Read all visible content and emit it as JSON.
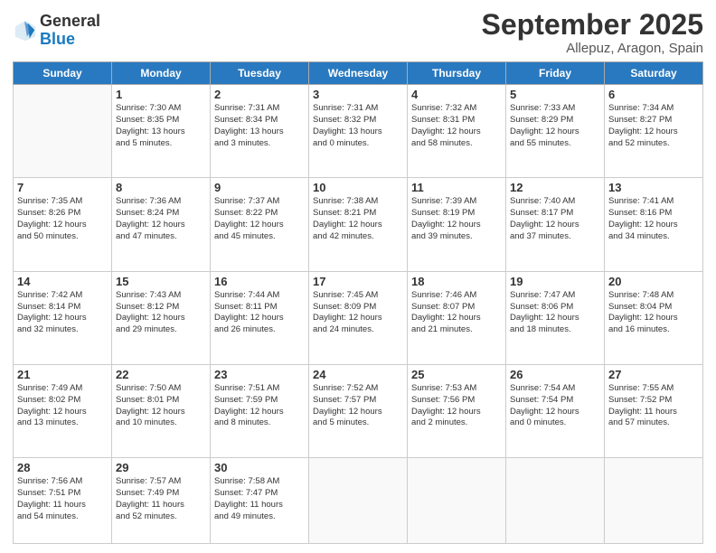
{
  "logo": {
    "general": "General",
    "blue": "Blue"
  },
  "header": {
    "title": "September 2025",
    "subtitle": "Allepuz, Aragon, Spain"
  },
  "days_of_week": [
    "Sunday",
    "Monday",
    "Tuesday",
    "Wednesday",
    "Thursday",
    "Friday",
    "Saturday"
  ],
  "weeks": [
    [
      {
        "day": "",
        "info": ""
      },
      {
        "day": "1",
        "info": "Sunrise: 7:30 AM\nSunset: 8:35 PM\nDaylight: 13 hours\nand 5 minutes."
      },
      {
        "day": "2",
        "info": "Sunrise: 7:31 AM\nSunset: 8:34 PM\nDaylight: 13 hours\nand 3 minutes."
      },
      {
        "day": "3",
        "info": "Sunrise: 7:31 AM\nSunset: 8:32 PM\nDaylight: 13 hours\nand 0 minutes."
      },
      {
        "day": "4",
        "info": "Sunrise: 7:32 AM\nSunset: 8:31 PM\nDaylight: 12 hours\nand 58 minutes."
      },
      {
        "day": "5",
        "info": "Sunrise: 7:33 AM\nSunset: 8:29 PM\nDaylight: 12 hours\nand 55 minutes."
      },
      {
        "day": "6",
        "info": "Sunrise: 7:34 AM\nSunset: 8:27 PM\nDaylight: 12 hours\nand 52 minutes."
      }
    ],
    [
      {
        "day": "7",
        "info": "Sunrise: 7:35 AM\nSunset: 8:26 PM\nDaylight: 12 hours\nand 50 minutes."
      },
      {
        "day": "8",
        "info": "Sunrise: 7:36 AM\nSunset: 8:24 PM\nDaylight: 12 hours\nand 47 minutes."
      },
      {
        "day": "9",
        "info": "Sunrise: 7:37 AM\nSunset: 8:22 PM\nDaylight: 12 hours\nand 45 minutes."
      },
      {
        "day": "10",
        "info": "Sunrise: 7:38 AM\nSunset: 8:21 PM\nDaylight: 12 hours\nand 42 minutes."
      },
      {
        "day": "11",
        "info": "Sunrise: 7:39 AM\nSunset: 8:19 PM\nDaylight: 12 hours\nand 39 minutes."
      },
      {
        "day": "12",
        "info": "Sunrise: 7:40 AM\nSunset: 8:17 PM\nDaylight: 12 hours\nand 37 minutes."
      },
      {
        "day": "13",
        "info": "Sunrise: 7:41 AM\nSunset: 8:16 PM\nDaylight: 12 hours\nand 34 minutes."
      }
    ],
    [
      {
        "day": "14",
        "info": "Sunrise: 7:42 AM\nSunset: 8:14 PM\nDaylight: 12 hours\nand 32 minutes."
      },
      {
        "day": "15",
        "info": "Sunrise: 7:43 AM\nSunset: 8:12 PM\nDaylight: 12 hours\nand 29 minutes."
      },
      {
        "day": "16",
        "info": "Sunrise: 7:44 AM\nSunset: 8:11 PM\nDaylight: 12 hours\nand 26 minutes."
      },
      {
        "day": "17",
        "info": "Sunrise: 7:45 AM\nSunset: 8:09 PM\nDaylight: 12 hours\nand 24 minutes."
      },
      {
        "day": "18",
        "info": "Sunrise: 7:46 AM\nSunset: 8:07 PM\nDaylight: 12 hours\nand 21 minutes."
      },
      {
        "day": "19",
        "info": "Sunrise: 7:47 AM\nSunset: 8:06 PM\nDaylight: 12 hours\nand 18 minutes."
      },
      {
        "day": "20",
        "info": "Sunrise: 7:48 AM\nSunset: 8:04 PM\nDaylight: 12 hours\nand 16 minutes."
      }
    ],
    [
      {
        "day": "21",
        "info": "Sunrise: 7:49 AM\nSunset: 8:02 PM\nDaylight: 12 hours\nand 13 minutes."
      },
      {
        "day": "22",
        "info": "Sunrise: 7:50 AM\nSunset: 8:01 PM\nDaylight: 12 hours\nand 10 minutes."
      },
      {
        "day": "23",
        "info": "Sunrise: 7:51 AM\nSunset: 7:59 PM\nDaylight: 12 hours\nand 8 minutes."
      },
      {
        "day": "24",
        "info": "Sunrise: 7:52 AM\nSunset: 7:57 PM\nDaylight: 12 hours\nand 5 minutes."
      },
      {
        "day": "25",
        "info": "Sunrise: 7:53 AM\nSunset: 7:56 PM\nDaylight: 12 hours\nand 2 minutes."
      },
      {
        "day": "26",
        "info": "Sunrise: 7:54 AM\nSunset: 7:54 PM\nDaylight: 12 hours\nand 0 minutes."
      },
      {
        "day": "27",
        "info": "Sunrise: 7:55 AM\nSunset: 7:52 PM\nDaylight: 11 hours\nand 57 minutes."
      }
    ],
    [
      {
        "day": "28",
        "info": "Sunrise: 7:56 AM\nSunset: 7:51 PM\nDaylight: 11 hours\nand 54 minutes."
      },
      {
        "day": "29",
        "info": "Sunrise: 7:57 AM\nSunset: 7:49 PM\nDaylight: 11 hours\nand 52 minutes."
      },
      {
        "day": "30",
        "info": "Sunrise: 7:58 AM\nSunset: 7:47 PM\nDaylight: 11 hours\nand 49 minutes."
      },
      {
        "day": "",
        "info": ""
      },
      {
        "day": "",
        "info": ""
      },
      {
        "day": "",
        "info": ""
      },
      {
        "day": "",
        "info": ""
      }
    ]
  ]
}
